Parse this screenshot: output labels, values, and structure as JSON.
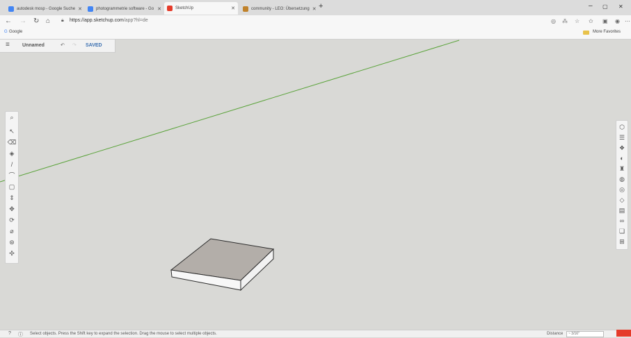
{
  "browser": {
    "tabs": [
      {
        "title": "autodesk mosp - Google Suche",
        "active": false,
        "icon_color": "#4285f4"
      },
      {
        "title": "photogrammetrie software - Go",
        "active": false,
        "icon_color": "#4285f4"
      },
      {
        "title": "SketchUp",
        "active": true,
        "icon_color": "#e53b2a"
      },
      {
        "title": "community - LEO: Übersetzung",
        "active": false,
        "icon_color": "#c0822b"
      }
    ],
    "new_tab": "+",
    "url_main": "https://app.sketchup.com",
    "url_rest": "/app?hl=de",
    "favorites_left": "Google",
    "favorites_right": "More Favorites",
    "window_controls": {
      "minimize": "–",
      "maximize": "▢",
      "close": "✕"
    },
    "nav": {
      "back": "←",
      "forward": "→",
      "refresh": "↻",
      "home": "⌂"
    }
  },
  "app": {
    "model_name": "Unnamed",
    "save_status": "SAVED",
    "status_text": "Select objects. Press the Shift key to expand the selection. Drag the mouse to select multiple objects.",
    "measurements_label": "Distance",
    "measurements_value": "~ 3/16\"",
    "colors": {
      "axis_green": "#5aa33a",
      "box_top": "#b3aea9",
      "box_side": "#f6f6f6",
      "edge": "#2a2a2a",
      "brand": "#e53b2a"
    },
    "left_tools": [
      "search-icon",
      "select-arrow-icon",
      "eraser-icon",
      "paint-bucket-icon",
      "line-pencil-icon",
      "arc-icon",
      "rectangle-icon",
      "push-pull-icon",
      "move-icon",
      "rotate-icon",
      "tape-measure-icon",
      "orbit-icon",
      "pan-icon"
    ],
    "right_tools": [
      "entity-info-icon",
      "outliner-icon",
      "components-icon",
      "materials-icon",
      "styles-icon",
      "scenes-icon",
      "display-icon",
      "tags-icon",
      "instructor-icon",
      "views-icon",
      "extensions-icon",
      "3d-warehouse-icon"
    ]
  }
}
